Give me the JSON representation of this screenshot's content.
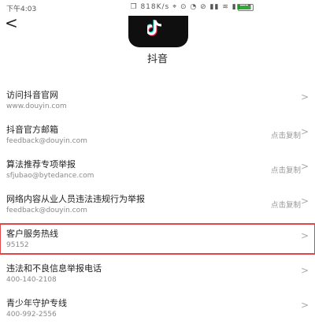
{
  "status_bar": {
    "time": "下午4:03",
    "network": "❒ 818K/s ⌖ ⊙ ◔ ⊘ ▮▮ ≋ ▮▮ ◨",
    "battery_level": 0.8,
    "battery_color": "#33aa33"
  },
  "header": {
    "back_icon": "chevron-left",
    "back_label": "<",
    "logo_icon": "douyin-logo",
    "app_name": "抖音"
  },
  "highlight_color": "#e0474a",
  "items": [
    {
      "title": "访问抖音官网",
      "subtitle": "www.douyin.com",
      "action": "",
      "chevron": ">"
    },
    {
      "title": "抖音官方邮箱",
      "subtitle": "feedback@douyin.com",
      "action": "点击复制",
      "chevron": ">"
    },
    {
      "title": "算法推荐专项举报",
      "subtitle": "sfjubao@bytedance.com",
      "action": "点击复制",
      "chevron": ">"
    },
    {
      "title": "网络内容从业人员违法违规行为举报",
      "subtitle": "feedback@douyin.com",
      "action": "点击复制",
      "chevron": ">"
    },
    {
      "title": "客户服务热线",
      "subtitle": "95152",
      "action": "",
      "chevron": ">"
    },
    {
      "title": "违法和不良信息举报电话",
      "subtitle": "400-140-2108",
      "action": "",
      "chevron": ">"
    },
    {
      "title": "青少年守护专线",
      "subtitle": "400-992-2556",
      "action": "",
      "chevron": ">"
    }
  ]
}
